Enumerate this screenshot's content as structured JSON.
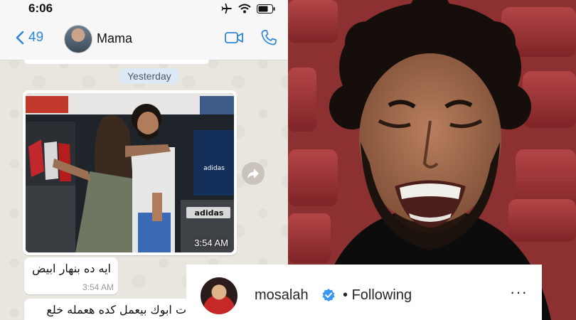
{
  "status_bar": {
    "time": "6:06"
  },
  "chat_header": {
    "back_count": "49",
    "contact_name": "Mama"
  },
  "date_separator": "Yesterday",
  "photo_message": {
    "time": "3:54 AM",
    "signage": [
      "adidas",
      "adidas"
    ]
  },
  "messages": [
    {
      "text": "ايه ده  بنهار ابيض",
      "time": "3:54 AM"
    },
    {
      "text": "ت ابوك بيعمل كده هعمله خلع"
    }
  ],
  "instagram": {
    "username": "mosalah",
    "separator": "•",
    "follow_status": "Following",
    "more": "···"
  },
  "icons": {
    "airplane": "airplane-icon",
    "wifi": "wifi-icon",
    "battery": "battery-icon",
    "back": "chevron-left-icon",
    "video": "video-call-icon",
    "phone": "phone-icon",
    "forward": "forward-icon",
    "verified": "verified-badge-icon",
    "more": "more-icon"
  },
  "colors": {
    "whatsapp_blue": "#2f86d6",
    "instagram_verified": "#3897f0",
    "chat_background": "#e9e5df"
  }
}
